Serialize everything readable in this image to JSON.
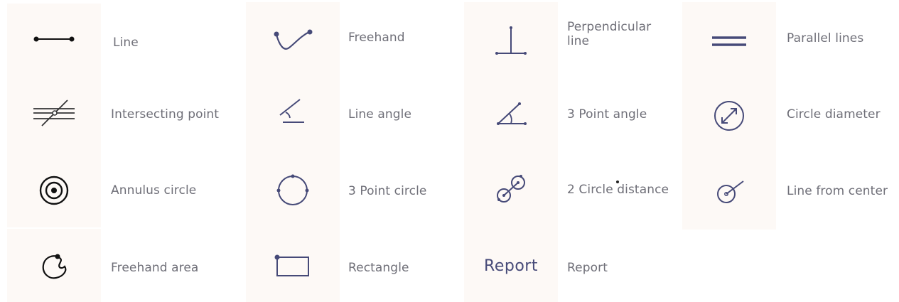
{
  "tools": {
    "line": {
      "label": "Line",
      "icon": "line-segment-icon"
    },
    "freehand": {
      "label": "Freehand",
      "icon": "freehand-curve-icon"
    },
    "perpendicular": {
      "label": "Perpendicular line",
      "icon": "perpendicular-line-icon"
    },
    "parallel": {
      "label": "Parallel lines",
      "icon": "parallel-lines-icon"
    },
    "intersecting": {
      "label": "Intersecting point",
      "icon": "intersecting-point-icon"
    },
    "line_angle": {
      "label": "Line angle",
      "icon": "line-angle-icon"
    },
    "three_point_angle": {
      "label": "3 Point angle",
      "icon": "three-point-angle-icon"
    },
    "circle_diameter": {
      "label": "Circle diameter",
      "icon": "circle-diameter-icon"
    },
    "annulus": {
      "label": "Annulus circle",
      "icon": "annulus-circle-icon"
    },
    "three_point_circle": {
      "label": "3 Point circle",
      "icon": "three-point-circle-icon"
    },
    "two_circle_distance": {
      "label": "2 Circle distance",
      "icon": "two-circle-distance-icon"
    },
    "line_from_center": {
      "label": "Line from center",
      "icon": "line-from-center-icon"
    },
    "freehand_area": {
      "label": "Freehand area",
      "icon": "freehand-area-icon"
    },
    "rectangle": {
      "label": "Rectangle",
      "icon": "rectangle-icon"
    },
    "report": {
      "label": "Report",
      "icon_text": "Report"
    }
  },
  "colors": {
    "tile_bg": "#fdf9f6",
    "icon_navy": "#464a78",
    "icon_black": "#111111",
    "label_gray": "#6f6f78"
  }
}
